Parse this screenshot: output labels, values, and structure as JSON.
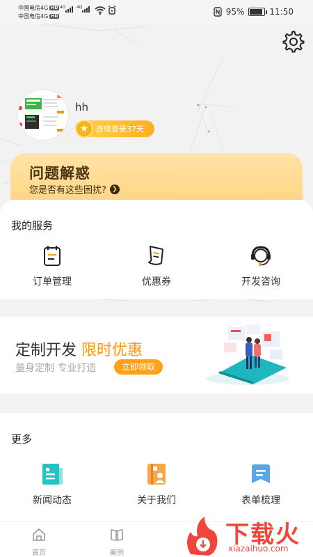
{
  "status_bar": {
    "carrier1": "中国电信4G",
    "carrier2": "中国电信4G",
    "hd": "HD",
    "net1": "4G",
    "net2": "4G",
    "battery": "95%",
    "time": "11:50"
  },
  "profile": {
    "username": "hh",
    "login_streak": "连续登录37天"
  },
  "question_card": {
    "title": "问题解惑",
    "subtitle": "您是否有这些困扰?"
  },
  "services": {
    "title": "我的服务",
    "items": [
      {
        "label": "订单管理",
        "icon": "clipboard-icon"
      },
      {
        "label": "优惠券",
        "icon": "coupon-icon"
      },
      {
        "label": "开发咨询",
        "icon": "headset-icon"
      }
    ]
  },
  "promo": {
    "title": "定制开发",
    "highlight": "限时优惠",
    "subtitle": "量身定制 专业打造",
    "button": "立即领取"
  },
  "more": {
    "title": "更多",
    "items": [
      {
        "label": "新闻动态",
        "icon": "news-icon"
      },
      {
        "label": "关于我们",
        "icon": "about-icon"
      },
      {
        "label": "表单梳理",
        "icon": "form-icon"
      }
    ]
  },
  "tabbar": {
    "items": [
      {
        "label": "首页",
        "icon": "home-icon"
      },
      {
        "label": "案例",
        "icon": "book-icon"
      }
    ]
  },
  "watermark": {
    "text": "下载火",
    "url": "xiazaihuo.com"
  },
  "colors": {
    "accent": "#ff9800",
    "teal": "#23c3c6",
    "orange_icon": "#f5a74a",
    "blue_icon": "#5aa6e6"
  }
}
